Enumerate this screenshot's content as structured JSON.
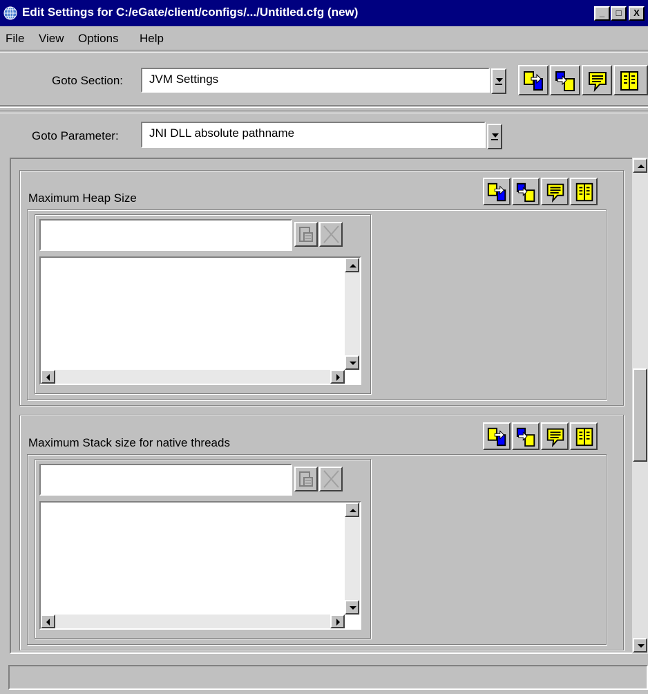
{
  "window": {
    "title": "Edit Settings for C:/eGate/client/configs/.../Untitled.cfg (new)",
    "controls": {
      "minimize": "_",
      "maximize": "□",
      "close": "X"
    }
  },
  "menu": [
    {
      "label": "File"
    },
    {
      "label": "View"
    },
    {
      "label": "Options"
    },
    {
      "label": "Help"
    }
  ],
  "goto_section": {
    "label": "Goto Section:",
    "value": "JVM Settings"
  },
  "goto_parameter": {
    "label": "Goto Parameter:",
    "value": "JNI DLL absolute pathname"
  },
  "toolbar_icons": [
    "copy-from-file-icon",
    "paste-icon",
    "comment-icon",
    "book-icon"
  ],
  "parameters": [
    {
      "title": "Maximum Heap Size",
      "value": ""
    },
    {
      "title": "Maximum Stack size for native threads",
      "value": ""
    }
  ],
  "status": {
    "text": ""
  },
  "colors": {
    "title_bar": "#000080",
    "window_face": "#c0c0c0",
    "icon_yellow": "#ffff00",
    "icon_blue": "#0000ff"
  }
}
